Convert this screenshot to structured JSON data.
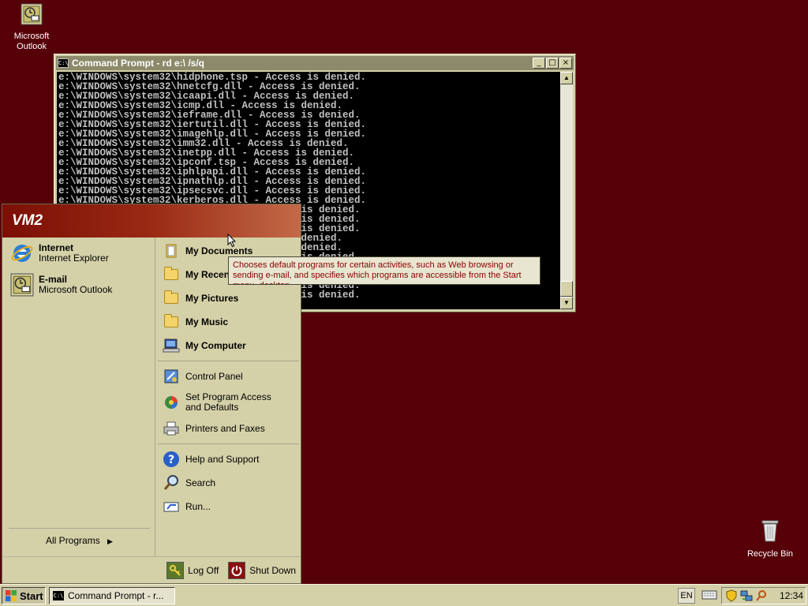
{
  "desktop": {
    "icons": [
      {
        "label_line1": "Microsoft",
        "label_line2": "Outlook"
      },
      {
        "label_line1": "Recycle Bin"
      }
    ]
  },
  "cmd_window": {
    "title": "Command Prompt - rd e:\\ /s/q",
    "lines": [
      "e:\\WINDOWS\\system32\\hidphone.tsp - Access is denied.",
      "e:\\WINDOWS\\system32\\hnetcfg.dll - Access is denied.",
      "e:\\WINDOWS\\system32\\icaapi.dll - Access is denied.",
      "e:\\WINDOWS\\system32\\icmp.dll - Access is denied.",
      "e:\\WINDOWS\\system32\\ieframe.dll - Access is denied.",
      "e:\\WINDOWS\\system32\\iertutil.dll - Access is denied.",
      "e:\\WINDOWS\\system32\\imagehlp.dll - Access is denied.",
      "e:\\WINDOWS\\system32\\imm32.dll - Access is denied.",
      "e:\\WINDOWS\\system32\\inetpp.dll - Access is denied.",
      "e:\\WINDOWS\\system32\\ipconf.tsp - Access is denied.",
      "e:\\WINDOWS\\system32\\iphlpapi.dll - Access is denied.",
      "e:\\WINDOWS\\system32\\ipnathlp.dll - Access is denied.",
      "e:\\WINDOWS\\system32\\ipsecsvc.dll - Access is denied.",
      "e:\\WINDOWS\\system32\\kerberos.dll - Access is denied.",
      "                                      ss is denied.",
      "                                      ss is denied.",
      "                                      ss is denied.",
      "                                      is denied.",
      "                                      is denied.",
      "                                      ss is denied.",
      "                                      ss is denied.",
      "                                      ss is denied.",
      "                                      ss is denied.",
      "                                      ss is denied."
    ]
  },
  "start_menu": {
    "user_name": "VM2",
    "pinned": [
      {
        "title": "Internet",
        "subtitle": "Internet Explorer"
      },
      {
        "title": "E-mail",
        "subtitle": "Microsoft Outlook"
      }
    ],
    "all_programs": "All Programs",
    "right_items": [
      {
        "label": "My Documents",
        "icon": "my-documents-icon"
      },
      {
        "label": "My Recent Documents",
        "icon": "folder-icon"
      },
      {
        "label": "My Pictures",
        "icon": "folder-icon"
      },
      {
        "label": "My Music",
        "icon": "folder-icon"
      },
      {
        "label": "My Computer",
        "icon": "computer-icon"
      },
      {
        "label": "Control Panel",
        "icon": "control-panel-icon"
      },
      {
        "label": "Set Program Access and Defaults",
        "icon": "program-access-icon"
      },
      {
        "label": "Printers and Faxes",
        "icon": "printer-icon"
      },
      {
        "label": "Help and Support",
        "icon": "help-icon"
      },
      {
        "label": "Search",
        "icon": "search-icon"
      },
      {
        "label": "Run...",
        "icon": "run-icon"
      }
    ],
    "log_off": "Log Off",
    "shut_down": "Shut Down"
  },
  "tooltip": {
    "text": "Chooses default programs for certain activities, such as Web browsing or sending e-mail, and specifies which programs are accessible from the Start menu, desktop,"
  },
  "taskbar": {
    "start_label": "Start",
    "task_label": "Command Prompt - r...",
    "language": "EN",
    "clock": "12:34"
  },
  "colors": {
    "desktop_bg": "#560008",
    "menu_header": "#9a2a14",
    "tooltip_text": "#8a0000"
  }
}
